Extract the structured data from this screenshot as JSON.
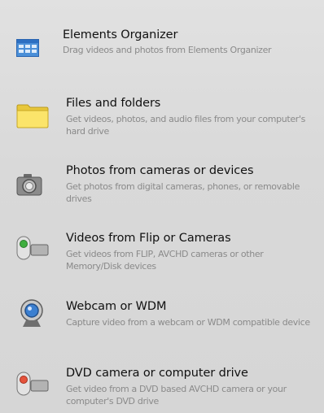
{
  "sources": [
    {
      "title": "Elements Organizer",
      "description": "Drag videos and photos from Elements Organizer",
      "icon": "organizer-grid-icon"
    },
    {
      "title": "Files and folders",
      "description": "Get videos, photos, and audio files from your computer's hard drive",
      "icon": "folder-icon"
    },
    {
      "title": "Photos from cameras or devices",
      "description": "Get photos from digital cameras, phones, or removable drives",
      "icon": "photo-camera-icon"
    },
    {
      "title": "Videos from Flip or Cameras",
      "description": "Get videos from FLIP, AVCHD cameras or other Memory/Disk devices",
      "icon": "video-camera-icon"
    },
    {
      "title": "Webcam or WDM",
      "description": "Capture video from a webcam or WDM compatible device",
      "icon": "webcam-icon"
    },
    {
      "title": "DVD camera or computer drive",
      "description": "Get video from a DVD based AVCHD camera or your computer's DVD drive",
      "icon": "dvd-camera-icon"
    }
  ]
}
